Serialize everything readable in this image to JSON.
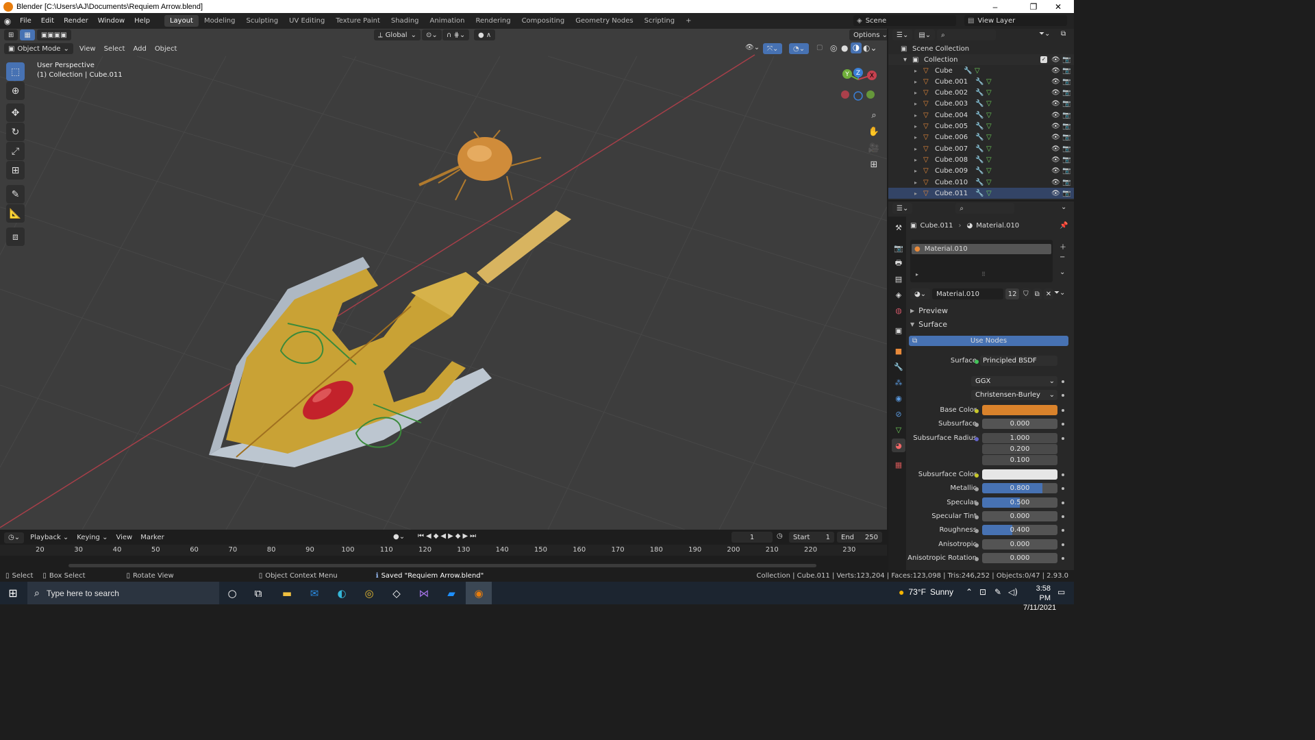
{
  "window": {
    "title": "Blender [C:\\Users\\AJ\\Documents\\Requiem Arrow.blend]",
    "controls": [
      "–",
      "❐",
      "✕"
    ]
  },
  "menu": {
    "items": [
      "File",
      "Edit",
      "Render",
      "Window",
      "Help"
    ],
    "workspaces": [
      "Layout",
      "Modeling",
      "Sculpting",
      "UV Editing",
      "Texture Paint",
      "Shading",
      "Animation",
      "Rendering",
      "Compositing",
      "Geometry Nodes",
      "Scripting"
    ],
    "active_workspace": "Layout",
    "add_workspace": "+",
    "scene": "Scene",
    "view_layer": "View Layer"
  },
  "viewport": {
    "mode": "Object Mode",
    "menus": [
      "View",
      "Select",
      "Add",
      "Object"
    ],
    "orientation": "Global",
    "options": "Options",
    "perspective": "User Perspective",
    "collection_info": "(1) Collection | Cube.011",
    "gizmo": {
      "x": "X",
      "y": "Y",
      "z": "Z"
    },
    "bg_color": "#3d3d3d"
  },
  "timeline": {
    "menus": [
      "Playback",
      "Keying",
      "View",
      "Marker"
    ],
    "current_frame": "1",
    "start_label": "Start",
    "start_value": "1",
    "end_label": "End",
    "end_value": "250",
    "ruler": [
      "20",
      "30",
      "40",
      "50",
      "60",
      "70",
      "80",
      "90",
      "100",
      "110",
      "120",
      "130",
      "140",
      "150",
      "160",
      "170",
      "180",
      "190",
      "200",
      "210",
      "220",
      "230"
    ]
  },
  "outliner": {
    "root": "Scene Collection",
    "collection": "Collection",
    "objects": [
      "Cube",
      "Cube.001",
      "Cube.002",
      "Cube.003",
      "Cube.004",
      "Cube.005",
      "Cube.006",
      "Cube.007",
      "Cube.008",
      "Cube.009",
      "Cube.010",
      "Cube.011"
    ]
  },
  "properties": {
    "object": "Cube.011",
    "material": "Material.010",
    "slot": "Material.010",
    "material_users": "12",
    "preview_label": "Preview",
    "surface_label": "Surface",
    "use_nodes": "Use Nodes",
    "surface_shader_label": "Surface",
    "surface_shader": "Principled BSDF",
    "distribution": "GGX",
    "subsurface_method": "Christensen-Burley",
    "fields": [
      {
        "label": "Base Color",
        "type": "color",
        "value": "",
        "color": "#d9822b"
      },
      {
        "label": "Subsurface",
        "type": "value",
        "value": "0.000",
        "fill": 0
      },
      {
        "label": "Subsurface Radius",
        "type": "vector",
        "values": [
          "1.000",
          "0.200",
          "0.100"
        ]
      },
      {
        "label": "Subsurface Color",
        "type": "color",
        "value": "",
        "color": "#e6e6e6"
      },
      {
        "label": "Metallic",
        "type": "value",
        "value": "0.800",
        "fill": 0.8
      },
      {
        "label": "Specular",
        "type": "value",
        "value": "0.500",
        "fill": 0.5
      },
      {
        "label": "Specular Tint",
        "type": "value",
        "value": "0.000",
        "fill": 0
      },
      {
        "label": "Roughness",
        "type": "value",
        "value": "0.400",
        "fill": 0.4
      },
      {
        "label": "Anisotropic",
        "type": "value",
        "value": "0.000",
        "fill": 0
      },
      {
        "label": "Anisotropic Rotation",
        "type": "value",
        "value": "0.000",
        "fill": 0
      }
    ]
  },
  "status": {
    "select": "Select",
    "box_select": "Box Select",
    "rotate_view": "Rotate View",
    "context_menu": "Object Context Menu",
    "saved": "Saved \"Requiem Arrow.blend\"",
    "stats": "Collection | Cube.011 | Verts:123,204 | Faces:123,098 | Tris:246,252 | Objects:0/47 | 2.93.0"
  },
  "taskbar": {
    "search_placeholder": "Type here to search",
    "weather_temp": "73°F",
    "weather_text": "Sunny",
    "time": "3:58 PM",
    "date": "7/11/2021"
  },
  "colors": {
    "accent": "#4772b3",
    "blender_orange": "#e87d0d",
    "axis_x": "#c6414f",
    "axis_y": "#6fae3a",
    "axis_z": "#3a7fd6"
  }
}
